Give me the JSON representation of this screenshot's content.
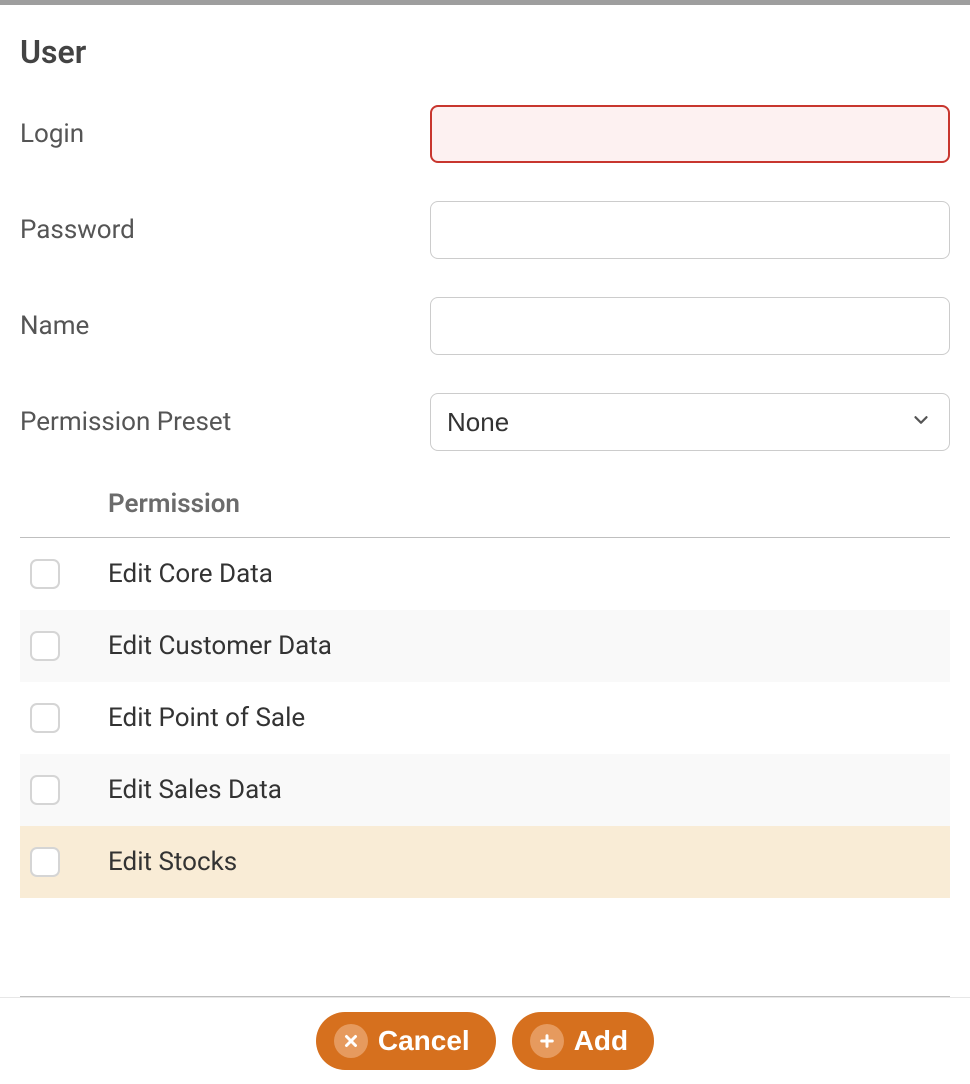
{
  "title": "User",
  "form": {
    "login": {
      "label": "Login",
      "value": "",
      "error": true
    },
    "password": {
      "label": "Password",
      "value": ""
    },
    "name": {
      "label": "Name",
      "value": ""
    },
    "permission_preset": {
      "label": "Permission Preset",
      "selected": "None"
    }
  },
  "permissions": {
    "header": "Permission",
    "items": [
      {
        "label": "Edit Core Data",
        "checked": false
      },
      {
        "label": "Edit Customer Data",
        "checked": false
      },
      {
        "label": "Edit Point of Sale",
        "checked": false
      },
      {
        "label": "Edit Sales Data",
        "checked": false
      },
      {
        "label": "Edit Stocks",
        "checked": false,
        "highlight": true
      }
    ]
  },
  "footer": {
    "cancel_label": "Cancel",
    "add_label": "Add"
  },
  "colors": {
    "accent": "#d6701e"
  }
}
